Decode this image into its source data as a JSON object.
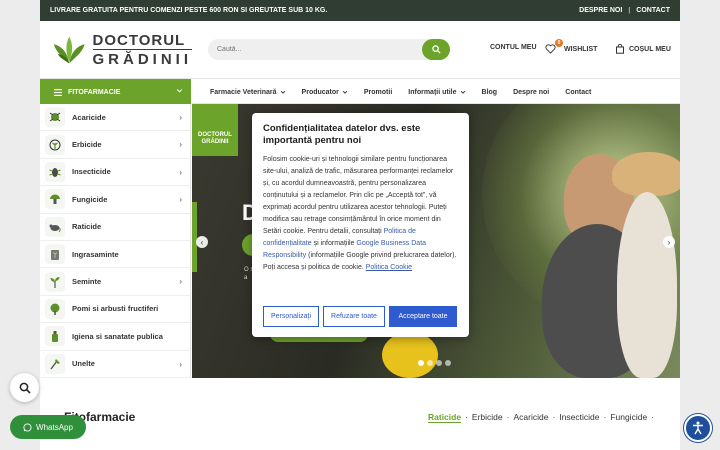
{
  "topbar": {
    "promo": "LIVRARE GRATUITA PENTRU COMENZI PESTE 600 RON SI GREUTATE SUB 10 KG.",
    "links": [
      "DESPRE NOI",
      "CONTACT"
    ],
    "separator": "|"
  },
  "header": {
    "logo_line1": "DOCTORUL",
    "logo_line2": "GRĂDINII",
    "search_placeholder": "Caută...",
    "account_label": "CONTUL MEU",
    "wishlist_label": "WISHLIST",
    "wishlist_count": "0",
    "cart_label": "COȘUL MEU"
  },
  "nav": {
    "category_button": "FITOFARMACIE",
    "items": [
      {
        "label": "Farmacie Veterinară",
        "dropdown": true
      },
      {
        "label": "Producator",
        "dropdown": true
      },
      {
        "label": "Promotii",
        "dropdown": false
      },
      {
        "label": "Informații utile",
        "dropdown": true
      },
      {
        "label": "Blog",
        "dropdown": false
      },
      {
        "label": "Despre noi",
        "dropdown": false
      },
      {
        "label": "Contact",
        "dropdown": false
      }
    ]
  },
  "sidebar": {
    "items": [
      {
        "label": "Acaricide",
        "arrow": true
      },
      {
        "label": "Erbicide",
        "arrow": true
      },
      {
        "label": "Insecticide",
        "arrow": true
      },
      {
        "label": "Fungicide",
        "arrow": true
      },
      {
        "label": "Raticide",
        "arrow": false
      },
      {
        "label": "Ingrasaminte",
        "arrow": false
      },
      {
        "label": "Seminte",
        "arrow": true
      },
      {
        "label": "Pomi si arbusti fructiferi",
        "arrow": false
      },
      {
        "label": "Igiena si sanatate publica",
        "arrow": false
      },
      {
        "label": "Unelte",
        "arrow": true
      }
    ]
  },
  "hero": {
    "logo_line1": "DOCTORUL",
    "logo_line2": "GRĂDINII",
    "headline_letter": "D",
    "small_text": "O s c c a"
  },
  "cookie": {
    "title": "Confidențialitatea datelor dvs. este importantă pentru noi",
    "body": "Folosim cookie-uri și tehnologii similare pentru funcționarea site-ului, analiză de trafic, măsurarea performanței reclamelor și, cu acordul dumneavoastră, pentru personalizarea conținutului și a reclamelor. Prin clic pe „Acceptă tot”, vă exprimați acordul pentru utilizarea acestor tehnologii. Puteți modifica sau retrage consimțământul în orice moment din Setări cookie. Pentru detalii, consultați ",
    "link1": "Politica de confidențialitate",
    "and_text": " și informațiile ",
    "link2": "Google Business Data Responsibility",
    "tail": " (informațiile Google privind prelucrarea datelor). Poți accesa și politica de cookie. ",
    "link3": "Politica Cookie",
    "btn_customize": "Personalizați",
    "btn_reject": "Refuzare toate",
    "btn_accept": "Acceptare toate"
  },
  "section": {
    "title": "Fitofarmacie",
    "tabs": [
      "Raticide",
      "Erbicide",
      "Acaricide",
      "Insecticide",
      "Fungicide"
    ],
    "active_tab": "Raticide"
  },
  "whatsapp_label": "WhatsApp",
  "colors": {
    "brand_green": "#6ca32a",
    "topbar_bg": "#2f3d32",
    "cookie_blue": "#2f5bd0",
    "accessibility_blue": "#1f4f9c"
  }
}
